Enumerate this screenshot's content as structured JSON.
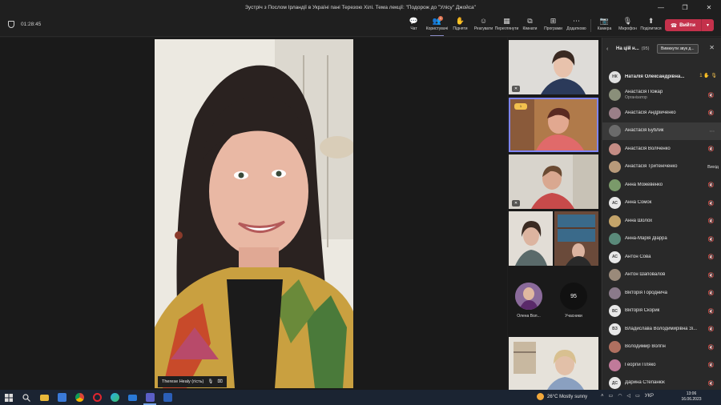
{
  "window": {
    "title": "Зустріч з Послом Ірландії в Україні пані Терезою Хілі. Тема лекції: \"Подорож до \"Улісу\" Джойса\"",
    "controls": [
      "—",
      "❐",
      "✕"
    ]
  },
  "meeting": {
    "elapsed": "01:28:45"
  },
  "toolbar": {
    "items": [
      {
        "label": "Чат",
        "icon": "chat-icon",
        "glyph": "💬"
      },
      {
        "label": "Користувачі",
        "icon": "people-icon",
        "glyph": "👥",
        "badge": "1"
      },
      {
        "label": "Підняти",
        "icon": "raise-hand-icon",
        "glyph": "✋"
      },
      {
        "label": "Реагувати",
        "icon": "react-icon",
        "glyph": "☺"
      },
      {
        "label": "Переглянути",
        "icon": "view-icon",
        "glyph": "▦"
      },
      {
        "label": "Кімнати",
        "icon": "rooms-icon",
        "glyph": "⧉"
      },
      {
        "label": "Програми",
        "icon": "apps-icon",
        "glyph": "⊞"
      },
      {
        "label": "Додатково",
        "icon": "more-icon",
        "glyph": "⋯"
      }
    ],
    "media": [
      {
        "label": "Камера",
        "icon": "camera-icon",
        "glyph": "📷"
      },
      {
        "label": "Мікрофон",
        "icon": "microphone-icon",
        "glyph": "🎙"
      },
      {
        "label": "Поділитися",
        "icon": "share-icon",
        "glyph": "⬆"
      }
    ],
    "leave_label": "Вийти"
  },
  "main_video": {
    "speaker_name": "Therese Healy (гість)"
  },
  "gallery": {
    "avatar_tiles": [
      {
        "name": "Олена Вол...",
        "initials": ""
      },
      {
        "name": "Учасники",
        "initials": "95"
      }
    ],
    "hand_raise_badge": "1"
  },
  "people_panel": {
    "title": "На цій н...",
    "count": "(95)",
    "mute_all_label": "Вимкнути звук д...",
    "hand_count": "1",
    "participants": [
      {
        "name": "Наталія Олександрівна...",
        "initials": "НК",
        "color": "#e0e0e0",
        "bold": true
      },
      {
        "name": "Анастасія Пожар",
        "role": "Організатор",
        "initials": "",
        "color": "#8a8f7a"
      },
      {
        "name": "Анастасія Андрійченко",
        "initials": "",
        "color": "#9a7f88"
      },
      {
        "name": "Анастасія Бублик",
        "initials": "",
        "color": "#6b6b6b",
        "highlight": true
      },
      {
        "name": "Анастасія Воліченко",
        "initials": "",
        "color": "#c48c84"
      },
      {
        "name": "Анастасія Тритеніченко",
        "initials": "",
        "color": "#b89a7a",
        "extra": "Вихід"
      },
      {
        "name": "Анна Можевенко",
        "initials": "",
        "color": "#7a9a6a"
      },
      {
        "name": "Анна Сомок",
        "initials": "АС",
        "color": "#e8e8e8"
      },
      {
        "name": "Анна Шолох",
        "initials": "",
        "color": "#c4a46a"
      },
      {
        "name": "Анна-Марія Діарра",
        "initials": "",
        "color": "#5a8a7a"
      },
      {
        "name": "Антон Сова",
        "initials": "АС",
        "color": "#e8e8e8"
      },
      {
        "name": "Антон Шаповалов",
        "initials": "",
        "color": "#9a8a7a"
      },
      {
        "name": "Вікторія Городнича",
        "initials": "",
        "color": "#8a7a8a"
      },
      {
        "name": "Вікторія Скорик",
        "initials": "ВС",
        "color": "#e8e8e8"
      },
      {
        "name": "Владислава Володимирівна Зі...",
        "initials": "ВЗ",
        "color": "#e8e8e8"
      },
      {
        "name": "Володимир Волгін",
        "initials": "",
        "color": "#b07060"
      },
      {
        "name": "Георгій Пляко",
        "initials": "",
        "color": "#c07a9a"
      },
      {
        "name": "Дарина Степанюк",
        "initials": "ДС",
        "color": "#e8e8e8"
      }
    ]
  },
  "taskbar": {
    "weather": "26°C  Mostly sunny",
    "language": "УКР",
    "time": "13:06",
    "date": "16.06.2023"
  }
}
